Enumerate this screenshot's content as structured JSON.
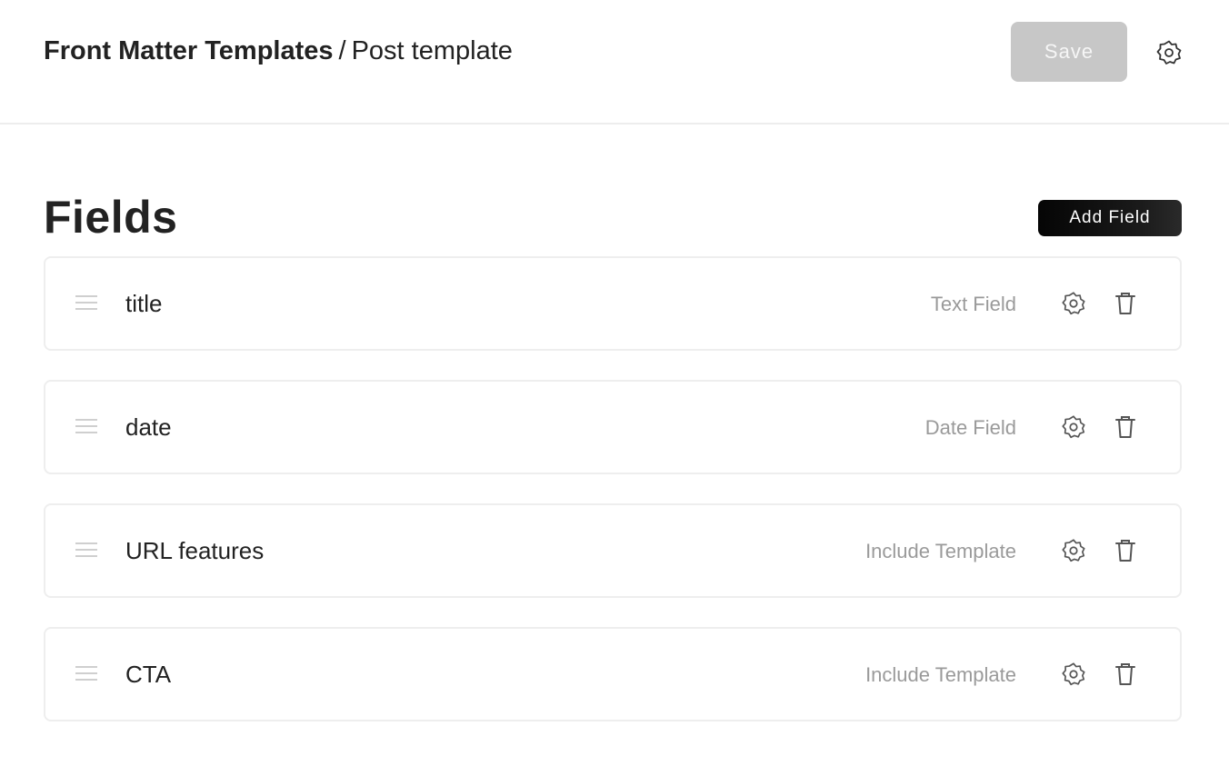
{
  "header": {
    "breadcrumb_root": "Front Matter Templates",
    "breadcrumb_separator": "/",
    "breadcrumb_current": "Post template",
    "save_label": "Save",
    "settings_icon": "gear-icon"
  },
  "section": {
    "title": "Fields",
    "add_label": "Add Field"
  },
  "fields": [
    {
      "name": "title",
      "type": "Text Field"
    },
    {
      "name": "date",
      "type": "Date Field"
    },
    {
      "name": "URL features",
      "type": "Include Template"
    },
    {
      "name": "CTA",
      "type": "Include Template"
    }
  ],
  "icons": {
    "drag": "drag-handle-icon",
    "settings": "gear-icon",
    "delete": "trash-icon"
  },
  "colors": {
    "save_disabled_bg": "#c7c7c7",
    "add_button_bg": "#0a0a0a",
    "muted_text": "#9a9a9a",
    "border": "#eeeeee"
  }
}
